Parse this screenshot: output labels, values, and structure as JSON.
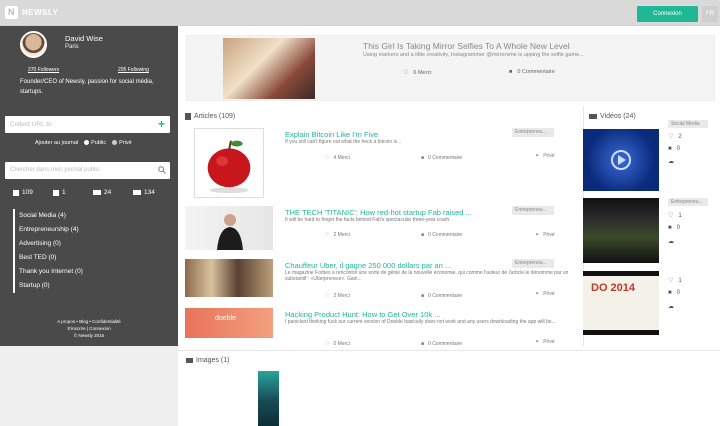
{
  "topbar": {
    "brand": "NEWSLY",
    "logo_letter": "N",
    "connexion": "Connexion",
    "lang": "FR"
  },
  "profile": {
    "name": "David Wise",
    "city": "Paris",
    "followers": "270 Followers",
    "following": "205 Following",
    "bio": "Founder/CEO of Newsly, passion for social média, startups."
  },
  "collect": {
    "placeholder": "Collect URL to",
    "plus": "+"
  },
  "addjournal": {
    "label": "Ajouter au journal",
    "public": "Public",
    "private": "Privé"
  },
  "search": {
    "placeholder": "Chercher dans mon journal public"
  },
  "stats": [
    {
      "icon": "article-icon",
      "value": "109"
    },
    {
      "icon": "image-icon",
      "value": "1"
    },
    {
      "icon": "video-icon",
      "value": "24"
    },
    {
      "icon": "list-icon",
      "value": "134"
    }
  ],
  "categories": [
    "Social Media (4)",
    "Entrepreneurship (4)",
    "Advertising (0)",
    "Best TED (0)",
    "Thank you Internet (0)",
    "Startup (0)"
  ],
  "footer": {
    "line1": "A propos • Blog • Confidentialité",
    "line2": "S'inscrire | Connexion",
    "line3": "© Newsly 2015"
  },
  "feature": {
    "title": "This Girl Is Taking Mirror Selfies To A Whole New Level",
    "desc": "Using markers and a little creativity, Instagrammer @mirrorsme is upping the selfie game...",
    "likes": "6 Merci",
    "comments": "0 Commentaire"
  },
  "sections": {
    "articles": "Articles (109)",
    "videos": "Vidéos (24)",
    "images": "Images (1)"
  },
  "articles": [
    {
      "title": "Explain Bitcoin Like I'm Five",
      "desc": "If you still can't figure out what the heck a bitcoin is...",
      "tag": "Entrepreneu...",
      "likes": "4 Merci",
      "comments": "0 Commentaire",
      "priv": "Privé"
    },
    {
      "title": "THE TECH 'TITANIC': How red-hot startup Fab raised ...",
      "desc": "It will be hard to forget the facts behind Fab's spectacular three-year crash.",
      "tag": "Entrepreneu...",
      "likes": "2 Merci",
      "comments": "0 Commentaire",
      "priv": "Privé"
    },
    {
      "title": "Chauffeur Uber, il gagne 250 000 dollars par an ...",
      "desc": "Le magazine Forbes a rencontré une sorte de génie de la nouvelle économie, qui comme l'auteur de l'article le dénomme par un substantif : «Uberpreneur». Gain...",
      "tag": "Entrepreneu...",
      "likes": "2 Merci",
      "comments": "0 Commentaire",
      "priv": "Privé"
    },
    {
      "title": "Hacking Product Hunt: How to Get Over 10k ...",
      "desc": "I panicked thinking fuck our current version of Doeble basically does not work and any users downloading the app will be...",
      "tag": "",
      "likes": "0 Merci",
      "comments": "0 Commentaire",
      "priv": "Privé"
    }
  ],
  "thumb_text": {
    "doeble": "doeble"
  },
  "videos": [
    {
      "tag": "Social Media",
      "likes": "2",
      "comments": "0"
    },
    {
      "tag": "Entrepreneu...",
      "likes": "1",
      "comments": "0"
    },
    {
      "tag": "",
      "likes": "1",
      "comments": "0",
      "thumb_text": "DO 2014"
    }
  ]
}
